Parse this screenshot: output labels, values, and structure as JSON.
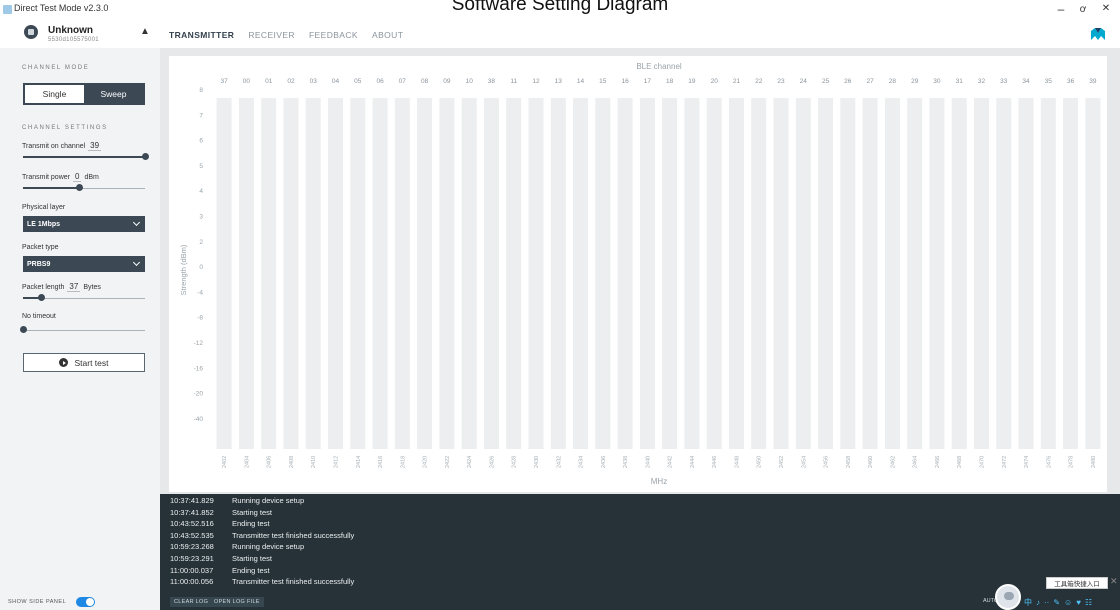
{
  "diagram_caption": "Software Setting Diagram",
  "window": {
    "title": "Direct Test Mode v2.3.0",
    "minimize": "–",
    "maximize": "ơ",
    "close": "✕"
  },
  "header": {
    "device_name": "Unknown",
    "device_serial": "5530d105575001",
    "eject_icon": "▲",
    "tabs": [
      "TRANSMITTER",
      "RECEIVER",
      "FEEDBACK",
      "ABOUT"
    ],
    "active_tab": 0,
    "brand_color": "#00a9ce"
  },
  "sidebar": {
    "channel_mode_title": "CHANNEL MODE",
    "mode_single": "Single",
    "mode_sweep": "Sweep",
    "mode_selected": "Single",
    "channel_settings_title": "CHANNEL SETTINGS",
    "transmit_channel_label": "Transmit on channel",
    "transmit_channel_value": "39",
    "transmit_channel_level": 1.0,
    "transmit_power_label": "Transmit power",
    "transmit_power_value": "0",
    "transmit_power_unit": "dBm",
    "transmit_power_level": 0.46,
    "physical_layer_label": "Physical layer",
    "physical_layer_value": "LE 1Mbps",
    "packet_type_label": "Packet type",
    "packet_type_value": "PRBS9",
    "packet_length_label": "Packet length",
    "packet_length_value": "37",
    "packet_length_unit": "Bytes",
    "packet_length_level": 0.15,
    "timeout_label": "No timeout",
    "timeout_level": 0.0,
    "start_button": "Start test",
    "show_side_panel": "SHOW SIDE PANEL"
  },
  "chart_data": {
    "type": "bar",
    "title": "BLE channel",
    "xlabel": "MHz",
    "ylabel": "Strength (dBm)",
    "channels": [
      "37",
      "00",
      "01",
      "02",
      "03",
      "04",
      "05",
      "06",
      "07",
      "08",
      "09",
      "10",
      "38",
      "11",
      "12",
      "13",
      "14",
      "15",
      "16",
      "17",
      "18",
      "19",
      "20",
      "21",
      "22",
      "23",
      "24",
      "25",
      "26",
      "27",
      "28",
      "29",
      "30",
      "31",
      "32",
      "33",
      "34",
      "35",
      "36",
      "39"
    ],
    "frequencies": [
      "2402",
      "2404",
      "2406",
      "2408",
      "2410",
      "2412",
      "2414",
      "2416",
      "2418",
      "2420",
      "2422",
      "2424",
      "2426",
      "2428",
      "2430",
      "2432",
      "2434",
      "2436",
      "2438",
      "2440",
      "2442",
      "2444",
      "2446",
      "2448",
      "2450",
      "2452",
      "2454",
      "2456",
      "2458",
      "2460",
      "2462",
      "2464",
      "2466",
      "2468",
      "2470",
      "2472",
      "2474",
      "2476",
      "2478",
      "2480"
    ],
    "y_ticks": [
      "8",
      "7",
      "6",
      "5",
      "4",
      "3",
      "2",
      "0",
      "-4",
      "-8",
      "-12",
      "-16",
      "-20",
      "-40"
    ],
    "values": [],
    "bar_color": "#eceeef",
    "axis_text_color": "#9aa3aa"
  },
  "log": {
    "lines": [
      {
        "time": "10:37:41.829",
        "msg": "Running device setup"
      },
      {
        "time": "10:37:41.852",
        "msg": "Starting test"
      },
      {
        "time": "10:43:52.516",
        "msg": "Ending test"
      },
      {
        "time": "10:43:52.535",
        "msg": "Transmitter test finished successfully"
      },
      {
        "time": "10:59:23.268",
        "msg": "Running device setup"
      },
      {
        "time": "10:59:23.291",
        "msg": "Starting test"
      },
      {
        "time": "11:00:00.037",
        "msg": "Ending test"
      },
      {
        "time": "11:00:00.056",
        "msg": "Transmitter test finished successfully"
      }
    ],
    "clear_button": "CLEAR LOG",
    "open_button": "OPEN LOG FILE",
    "autoscroll": "AUTO"
  },
  "overlay": {
    "tool_entry": "工具箱快捷入口",
    "tool_close": "✕",
    "tray_icons": [
      "中",
      "♪",
      "··",
      "✎",
      "☺",
      "♥",
      "☷"
    ]
  }
}
